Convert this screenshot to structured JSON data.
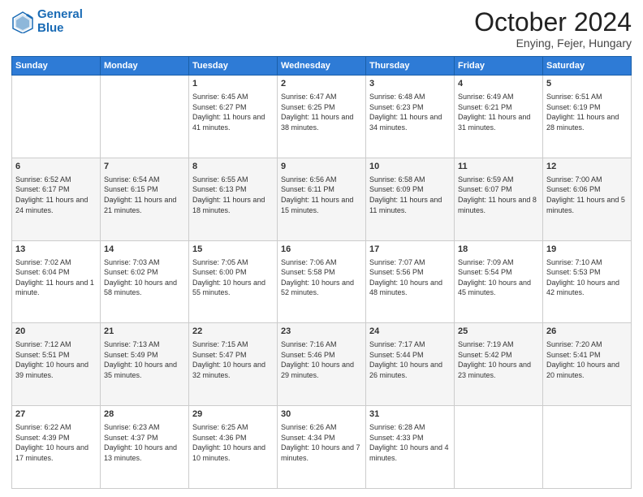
{
  "header": {
    "logo_line1": "General",
    "logo_line2": "Blue",
    "title": "October 2024",
    "subtitle": "Enying, Fejer, Hungary"
  },
  "days_of_week": [
    "Sunday",
    "Monday",
    "Tuesday",
    "Wednesday",
    "Thursday",
    "Friday",
    "Saturday"
  ],
  "weeks": [
    [
      {
        "day": "",
        "info": ""
      },
      {
        "day": "",
        "info": ""
      },
      {
        "day": "1",
        "info": "Sunrise: 6:45 AM\nSunset: 6:27 PM\nDaylight: 11 hours and 41 minutes."
      },
      {
        "day": "2",
        "info": "Sunrise: 6:47 AM\nSunset: 6:25 PM\nDaylight: 11 hours and 38 minutes."
      },
      {
        "day": "3",
        "info": "Sunrise: 6:48 AM\nSunset: 6:23 PM\nDaylight: 11 hours and 34 minutes."
      },
      {
        "day": "4",
        "info": "Sunrise: 6:49 AM\nSunset: 6:21 PM\nDaylight: 11 hours and 31 minutes."
      },
      {
        "day": "5",
        "info": "Sunrise: 6:51 AM\nSunset: 6:19 PM\nDaylight: 11 hours and 28 minutes."
      }
    ],
    [
      {
        "day": "6",
        "info": "Sunrise: 6:52 AM\nSunset: 6:17 PM\nDaylight: 11 hours and 24 minutes."
      },
      {
        "day": "7",
        "info": "Sunrise: 6:54 AM\nSunset: 6:15 PM\nDaylight: 11 hours and 21 minutes."
      },
      {
        "day": "8",
        "info": "Sunrise: 6:55 AM\nSunset: 6:13 PM\nDaylight: 11 hours and 18 minutes."
      },
      {
        "day": "9",
        "info": "Sunrise: 6:56 AM\nSunset: 6:11 PM\nDaylight: 11 hours and 15 minutes."
      },
      {
        "day": "10",
        "info": "Sunrise: 6:58 AM\nSunset: 6:09 PM\nDaylight: 11 hours and 11 minutes."
      },
      {
        "day": "11",
        "info": "Sunrise: 6:59 AM\nSunset: 6:07 PM\nDaylight: 11 hours and 8 minutes."
      },
      {
        "day": "12",
        "info": "Sunrise: 7:00 AM\nSunset: 6:06 PM\nDaylight: 11 hours and 5 minutes."
      }
    ],
    [
      {
        "day": "13",
        "info": "Sunrise: 7:02 AM\nSunset: 6:04 PM\nDaylight: 11 hours and 1 minute."
      },
      {
        "day": "14",
        "info": "Sunrise: 7:03 AM\nSunset: 6:02 PM\nDaylight: 10 hours and 58 minutes."
      },
      {
        "day": "15",
        "info": "Sunrise: 7:05 AM\nSunset: 6:00 PM\nDaylight: 10 hours and 55 minutes."
      },
      {
        "day": "16",
        "info": "Sunrise: 7:06 AM\nSunset: 5:58 PM\nDaylight: 10 hours and 52 minutes."
      },
      {
        "day": "17",
        "info": "Sunrise: 7:07 AM\nSunset: 5:56 PM\nDaylight: 10 hours and 48 minutes."
      },
      {
        "day": "18",
        "info": "Sunrise: 7:09 AM\nSunset: 5:54 PM\nDaylight: 10 hours and 45 minutes."
      },
      {
        "day": "19",
        "info": "Sunrise: 7:10 AM\nSunset: 5:53 PM\nDaylight: 10 hours and 42 minutes."
      }
    ],
    [
      {
        "day": "20",
        "info": "Sunrise: 7:12 AM\nSunset: 5:51 PM\nDaylight: 10 hours and 39 minutes."
      },
      {
        "day": "21",
        "info": "Sunrise: 7:13 AM\nSunset: 5:49 PM\nDaylight: 10 hours and 35 minutes."
      },
      {
        "day": "22",
        "info": "Sunrise: 7:15 AM\nSunset: 5:47 PM\nDaylight: 10 hours and 32 minutes."
      },
      {
        "day": "23",
        "info": "Sunrise: 7:16 AM\nSunset: 5:46 PM\nDaylight: 10 hours and 29 minutes."
      },
      {
        "day": "24",
        "info": "Sunrise: 7:17 AM\nSunset: 5:44 PM\nDaylight: 10 hours and 26 minutes."
      },
      {
        "day": "25",
        "info": "Sunrise: 7:19 AM\nSunset: 5:42 PM\nDaylight: 10 hours and 23 minutes."
      },
      {
        "day": "26",
        "info": "Sunrise: 7:20 AM\nSunset: 5:41 PM\nDaylight: 10 hours and 20 minutes."
      }
    ],
    [
      {
        "day": "27",
        "info": "Sunrise: 6:22 AM\nSunset: 4:39 PM\nDaylight: 10 hours and 17 minutes."
      },
      {
        "day": "28",
        "info": "Sunrise: 6:23 AM\nSunset: 4:37 PM\nDaylight: 10 hours and 13 minutes."
      },
      {
        "day": "29",
        "info": "Sunrise: 6:25 AM\nSunset: 4:36 PM\nDaylight: 10 hours and 10 minutes."
      },
      {
        "day": "30",
        "info": "Sunrise: 6:26 AM\nSunset: 4:34 PM\nDaylight: 10 hours and 7 minutes."
      },
      {
        "day": "31",
        "info": "Sunrise: 6:28 AM\nSunset: 4:33 PM\nDaylight: 10 hours and 4 minutes."
      },
      {
        "day": "",
        "info": ""
      },
      {
        "day": "",
        "info": ""
      }
    ]
  ]
}
